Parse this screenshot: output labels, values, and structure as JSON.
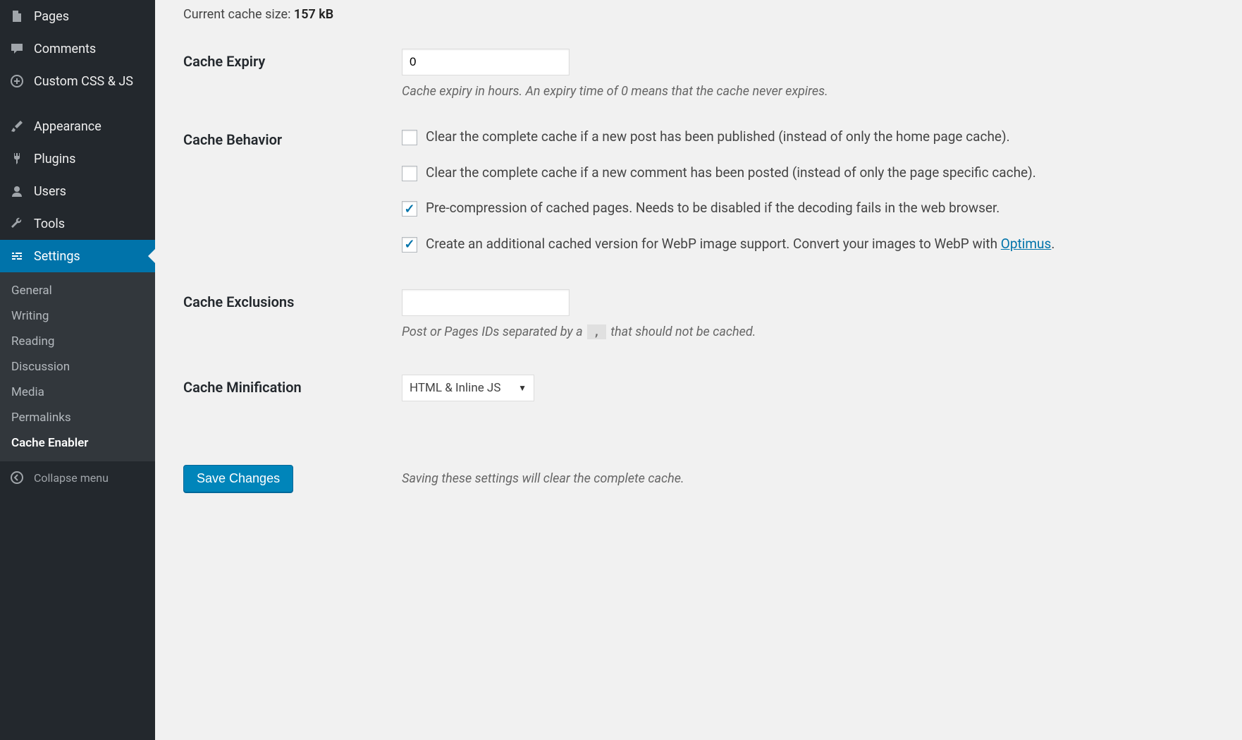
{
  "sidebar": {
    "items": [
      {
        "label": "Pages",
        "icon": "pages"
      },
      {
        "label": "Comments",
        "icon": "comments"
      },
      {
        "label": "Custom CSS & JS",
        "icon": "plus-circle"
      },
      {
        "label": "Appearance",
        "icon": "brush"
      },
      {
        "label": "Plugins",
        "icon": "plug"
      },
      {
        "label": "Users",
        "icon": "user"
      },
      {
        "label": "Tools",
        "icon": "wrench"
      },
      {
        "label": "Settings",
        "icon": "sliders"
      }
    ],
    "sub": [
      {
        "label": "General"
      },
      {
        "label": "Writing"
      },
      {
        "label": "Reading"
      },
      {
        "label": "Discussion"
      },
      {
        "label": "Media"
      },
      {
        "label": "Permalinks"
      },
      {
        "label": "Cache Enabler"
      }
    ],
    "collapse": "Collapse menu"
  },
  "cache_size": {
    "label": "Current cache size: ",
    "value": "157 kB"
  },
  "expiry": {
    "label": "Cache Expiry",
    "value": "0",
    "desc": "Cache expiry in hours. An expiry time of 0 means that the cache never expires."
  },
  "behavior": {
    "label": "Cache Behavior",
    "opts": [
      {
        "checked": false,
        "text": "Clear the complete cache if a new post has been published (instead of only the home page cache)."
      },
      {
        "checked": false,
        "text": "Clear the complete cache if a new comment has been posted (instead of only the page specific cache)."
      },
      {
        "checked": true,
        "text": "Pre-compression of cached pages. Needs to be disabled if the decoding fails in the web browser."
      },
      {
        "checked": true,
        "text_pre": "Create an additional cached version for WebP image support. Convert your images to WebP with ",
        "link": "Optimus",
        "text_post": "."
      }
    ]
  },
  "exclusions": {
    "label": "Cache Exclusions",
    "value": "",
    "desc_pre": "Post or Pages IDs separated by a ",
    "chip": ",",
    "desc_post": " that should not be cached."
  },
  "minify": {
    "label": "Cache Minification",
    "value": "HTML & Inline JS"
  },
  "save": {
    "button": "Save Changes",
    "note": "Saving these settings will clear the complete cache."
  }
}
